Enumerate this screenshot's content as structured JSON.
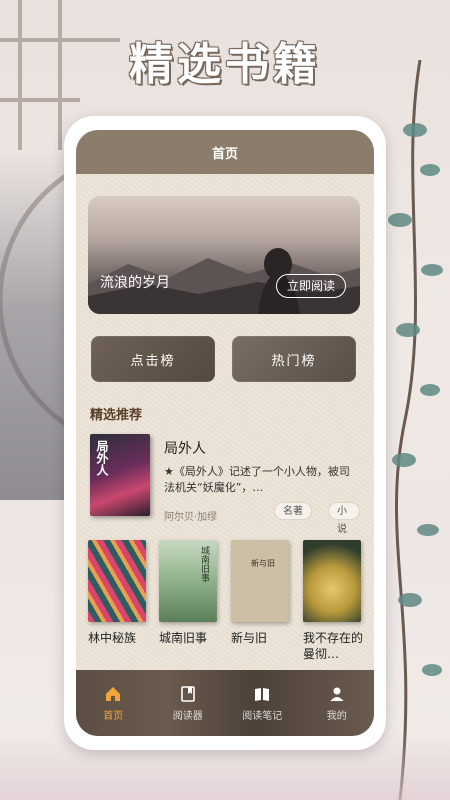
{
  "headline": "精选书籍",
  "app": {
    "title": "首页",
    "banner": {
      "title": "流浪的岁月",
      "button": "立即阅读"
    },
    "rank_buttons": {
      "click": "点击榜",
      "hot": "热门榜"
    },
    "section_title": "精选推荐",
    "featured": {
      "name": "局外人",
      "cover_text": "局外人",
      "desc": "★《局外人》记述了一个小人物，被司法机关“妖魔化”，…",
      "author": "阿尔贝·加缪",
      "tags": [
        "名著",
        "小说"
      ]
    },
    "books": [
      {
        "name": "林中秘族"
      },
      {
        "name": "城南旧事",
        "cover_text": "城南旧事"
      },
      {
        "name": "新与旧",
        "cover_text": "新与旧"
      },
      {
        "name": "我不存在的曼彻…"
      }
    ],
    "tabs": [
      {
        "label": "首页",
        "icon": "home-icon"
      },
      {
        "label": "阅读器",
        "icon": "book-icon"
      },
      {
        "label": "阅读笔记",
        "icon": "notes-icon"
      },
      {
        "label": "我的",
        "icon": "user-icon"
      }
    ],
    "colors": {
      "accent": "#f2a43b",
      "topbar": "#8b7c6c"
    }
  }
}
